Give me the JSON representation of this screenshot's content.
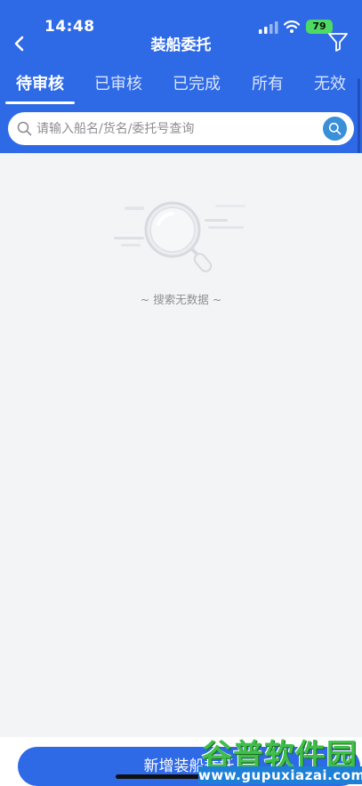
{
  "status_bar": {
    "time": "14:48",
    "battery": "79"
  },
  "nav": {
    "title": "装船委托"
  },
  "tabs": [
    {
      "label": "待审核",
      "active": true
    },
    {
      "label": "已审核",
      "active": false
    },
    {
      "label": "已完成",
      "active": false
    },
    {
      "label": "所有",
      "active": false
    },
    {
      "label": "无效",
      "active": false
    }
  ],
  "search": {
    "placeholder": "请输入船名/货名/委托号查询",
    "value": ""
  },
  "empty_state": {
    "text": "~ 搜索无数据 ~"
  },
  "footer": {
    "add_button_label": "新增装船委托"
  },
  "watermark": {
    "title": "谷普软件园",
    "url": "www.gupuxiazai.com"
  },
  "colors": {
    "primary": "#2f6ae6",
    "background": "#f3f4f6",
    "search_button": "#3a8fd9"
  },
  "icons": {
    "back": "chevron-left-icon",
    "filter": "filter-funnel-icon",
    "search": "magnifier-icon",
    "empty": "magnifier-illustration-icon"
  }
}
